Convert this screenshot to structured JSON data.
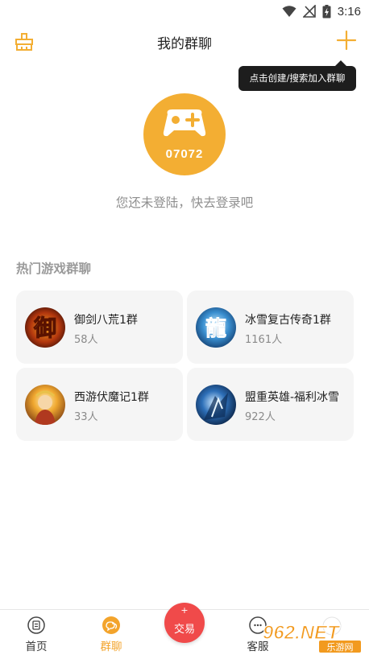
{
  "status_bar": {
    "time": "3:16",
    "icons": [
      "wifi-icon",
      "no-signal-icon",
      "battery-charging-icon"
    ]
  },
  "header": {
    "title": "我的群聊",
    "left_icon": "broom-icon",
    "right_icon": "plus-icon"
  },
  "tooltip": {
    "text": "点击创建/搜索加入群聊"
  },
  "profile": {
    "avatar_icon": "gamepad-icon",
    "avatar_number": "07072",
    "login_prompt": "您还未登陆，快去登录吧"
  },
  "hot_groups": {
    "title": "热门游戏群聊",
    "items": [
      {
        "name": "御剑八荒1群",
        "count": "58人",
        "avatar_text": "御"
      },
      {
        "name": "冰雪复古传奇1群",
        "count": "1161人",
        "avatar_text": "龍"
      },
      {
        "name": "西游伏魔记1群",
        "count": "33人"
      },
      {
        "name": "盟重英雄-福利冰雪",
        "count": "922人"
      }
    ]
  },
  "bottom_nav": {
    "items": [
      {
        "label": "首页",
        "icon": "home-icon"
      },
      {
        "label": "群聊",
        "icon": "chat-icon",
        "active": true
      },
      {
        "label": "客服",
        "icon": "service-icon"
      }
    ],
    "trade": {
      "label": "交易",
      "plus": "+"
    }
  },
  "watermark": {
    "text": "962.NET",
    "subtext": "乐游网"
  },
  "colors": {
    "accent": "#f3ae33",
    "trade": "#f04a4a",
    "card_bg": "#f5f5f5",
    "tooltip_bg": "#1d1d1d"
  }
}
